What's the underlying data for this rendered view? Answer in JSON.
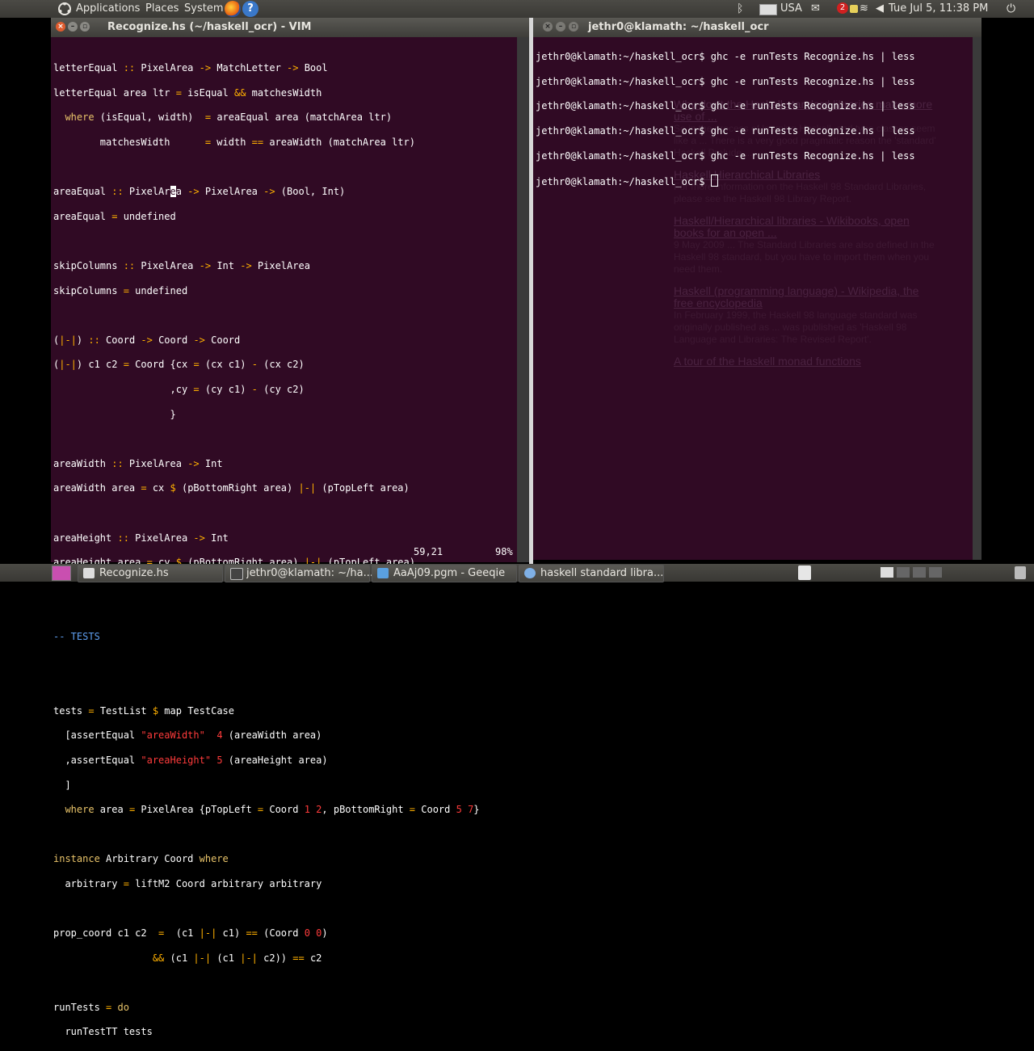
{
  "top_panel": {
    "menus": [
      "Applications",
      "Places",
      "System"
    ],
    "keyboard": "USA",
    "mail_count": "2",
    "clock": "Tue Jul  5, 11:38 PM"
  },
  "vim_window": {
    "title": "Recognize.hs (~/haskell_ocr) - VIM",
    "status_position": "59,21",
    "status_percent": "98%"
  },
  "terminal_window": {
    "title": "jethr0@klamath: ~/haskell_ocr",
    "lines": [
      "jethr0@klamath:~/haskell_ocr$ ghc -e runTests Recognize.hs | less",
      "jethr0@klamath:~/haskell_ocr$ ghc -e runTests Recognize.hs | less",
      "jethr0@klamath:~/haskell_ocr$ ghc -e runTests Recognize.hs | less",
      "jethr0@klamath:~/haskell_ocr$ ghc -e runTests Recognize.hs | less",
      "jethr0@klamath:~/haskell_ocr$ ghc -e runTests Recognize.hs | less"
    ],
    "prompt": "jethr0@klamath:~/haskell_ocr$ "
  },
  "taskbar": {
    "tasks": [
      "Recognize.hs",
      "jethr0@klamath: ~/ha...",
      "AaAj09.pgm - Geeqie",
      "haskell standard libra..."
    ]
  },
  "ghost_browser": {
    "results": [
      {
        "title": "Why don't the Haskell standard libraries make more use of ...",
        "text": "So in the process of learning Haskell, and type classes seem like a ... There is a very good pragmatic reason the 'standard' Haskell Prelude ..."
      },
      {
        "title": "Haskell Hierarchical Libraries",
        "text": "For more information on the Haskell 98 Standard Libraries, please see the Haskell 98 Library Report."
      },
      {
        "title": "Haskell/Hierarchical libraries - Wikibooks, open books for an open ...",
        "text": "9 May 2009 ... The Standard Libraries are also defined in the Haskell 98 standard, but you have to import them when you need them."
      },
      {
        "title": "Haskell (programming language) - Wikipedia, the free encyclopedia",
        "text": "In February 1999, the Haskell 98 language standard was originally published as ... was published as 'Haskell 98 Language and Libraries: The Revised Report'."
      },
      {
        "title": "A tour of the Haskell monad functions",
        "text": ""
      }
    ]
  }
}
